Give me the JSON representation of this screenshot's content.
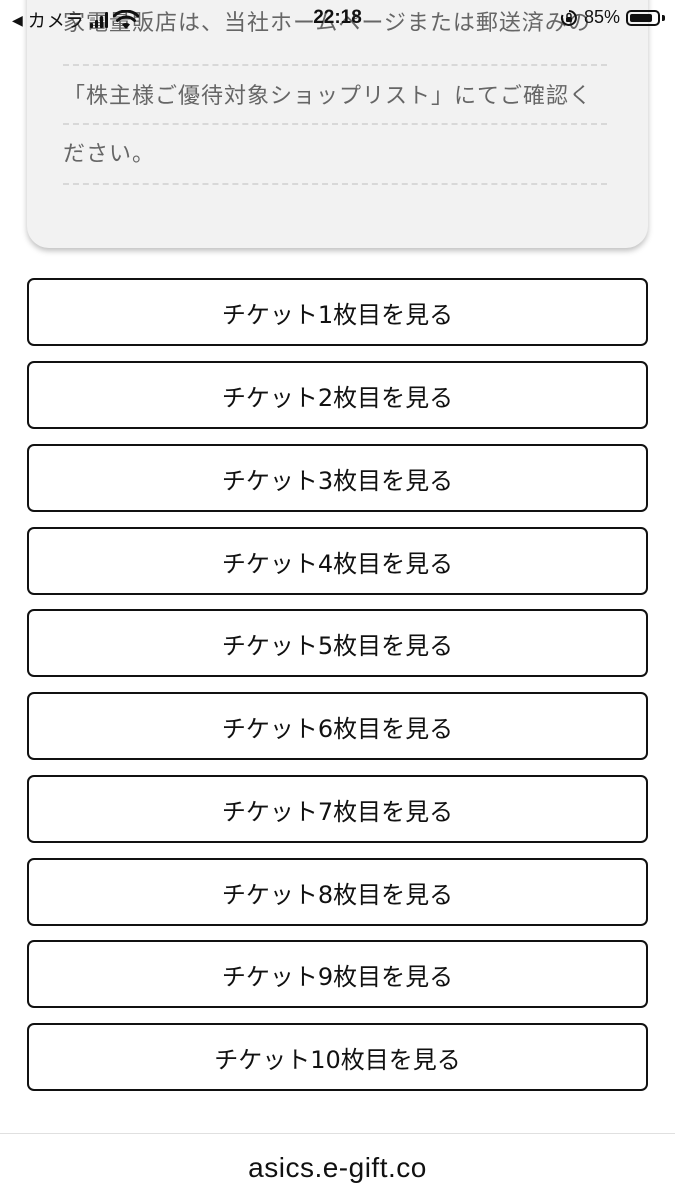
{
  "status_bar": {
    "back_label": "カメラ",
    "time": "22:18",
    "battery_percent": "85%",
    "battery_level": 0.85,
    "signal_bars": 4
  },
  "notice": {
    "lines": [
      "家電量販店は、当社ホームページまたは郵送済みの",
      "「株主様ご優待対象ショップリスト」にてご確認く",
      "ださい。"
    ]
  },
  "tickets": [
    {
      "label": "チケット1枚目を見る"
    },
    {
      "label": "チケット2枚目を見る"
    },
    {
      "label": "チケット3枚目を見る"
    },
    {
      "label": "チケット4枚目を見る"
    },
    {
      "label": "チケット5枚目を見る"
    },
    {
      "label": "チケット6枚目を見る"
    },
    {
      "label": "チケット7枚目を見る"
    },
    {
      "label": "チケット8枚目を見る"
    },
    {
      "label": "チケット9枚目を見る"
    },
    {
      "label": "チケット10枚目を見る"
    }
  ],
  "footer": {
    "url": "asics.e-gift.co"
  }
}
